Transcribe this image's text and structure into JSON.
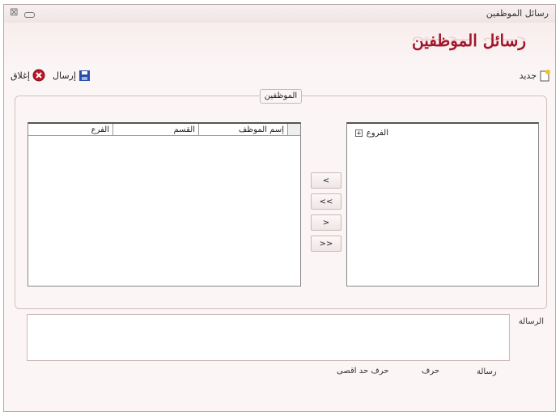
{
  "window": {
    "title": "رسائل الموظفين",
    "header": "رسائل الموظفين"
  },
  "toolbar": {
    "new_label": "جديد",
    "send_label": "إرسال",
    "close_label": "إغلاق"
  },
  "group": {
    "title": "الموظفين"
  },
  "tree": {
    "root_label": "الفروع",
    "expander": "+"
  },
  "table": {
    "columns": [
      "إسم الموظف",
      "القسم",
      "الفرع"
    ]
  },
  "buttons": {
    "b1": "<",
    "b2": "<<",
    "b3": ">",
    "b4": ">>"
  },
  "message": {
    "label": "الرسالة"
  },
  "counters": {
    "msg": "رسالة",
    "char": "حرف",
    "max": "حرف حد اقصى"
  },
  "colors": {
    "accent": "#a3162a"
  }
}
